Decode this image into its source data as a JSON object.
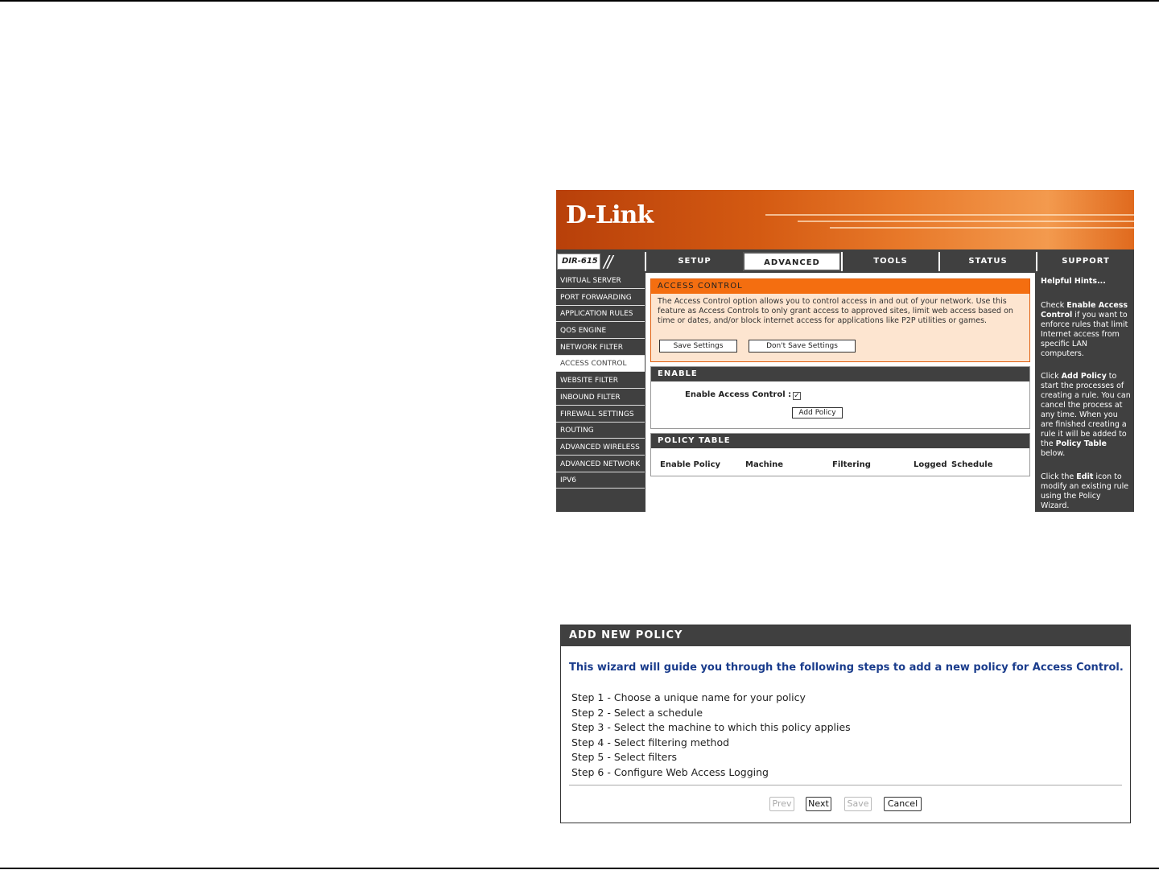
{
  "router": {
    "logo": "D-Link",
    "model": "DIR-615",
    "tabs": [
      "SETUP",
      "ADVANCED",
      "TOOLS",
      "STATUS",
      "SUPPORT"
    ],
    "active_tab": "ADVANCED",
    "left_nav": [
      "VIRTUAL SERVER",
      "PORT FORWARDING",
      "APPLICATION RULES",
      "QOS ENGINE",
      "NETWORK FILTER",
      "ACCESS CONTROL",
      "WEBSITE FILTER",
      "INBOUND FILTER",
      "FIREWALL SETTINGS",
      "ROUTING",
      "ADVANCED WIRELESS",
      "ADVANCED NETWORK",
      "IPV6"
    ],
    "active_nav": "ACCESS CONTROL",
    "access_control": {
      "title": "ACCESS CONTROL",
      "description": "The Access Control option allows you to control access in and out of your network. Use this feature as Access Controls to only grant access to approved sites, limit web access based on time or dates, and/or block internet access for applications like P2P utilities or games.",
      "save_label": "Save Settings",
      "dont_save_label": "Don't Save Settings"
    },
    "enable": {
      "title": "ENABLE",
      "label": "Enable Access Control :",
      "checked": "✓",
      "add_policy_label": "Add Policy"
    },
    "policy_table": {
      "title": "POLICY TABLE",
      "columns": [
        "Enable Policy",
        "Machine",
        "Filtering",
        "Logged",
        "Schedule"
      ]
    },
    "hints": {
      "title": "Helpful Hints...",
      "p1_a": "Check ",
      "p1_b": "Enable Access Control",
      "p1_c": " if you want to enforce rules that limit Internet access from specific LAN computers.",
      "p2_a": "Click ",
      "p2_b": "Add Policy",
      "p2_c": " to start the processes of creating a rule. You can cancel the process at any time. When you are finished creating a rule it will be added to the ",
      "p2_d": "Policy Table",
      "p2_e": " below.",
      "p3_a": "Click the ",
      "p3_b": "Edit",
      "p3_c": " icon to modify an existing rule using the Policy Wizard."
    }
  },
  "wizard": {
    "title": "ADD NEW POLICY",
    "lead": "This wizard will guide you through the following steps to add a new policy for Access Control.",
    "steps": [
      "Step 1 - Choose a unique name for your policy",
      "Step 2 - Select a schedule",
      "Step 3 - Select the machine to which this policy applies",
      "Step 4 - Select filtering method",
      "Step 5 - Select filters",
      "Step 6 - Configure Web Access Logging"
    ],
    "buttons": {
      "prev": "Prev",
      "next": "Next",
      "save": "Save",
      "cancel": "Cancel"
    }
  }
}
